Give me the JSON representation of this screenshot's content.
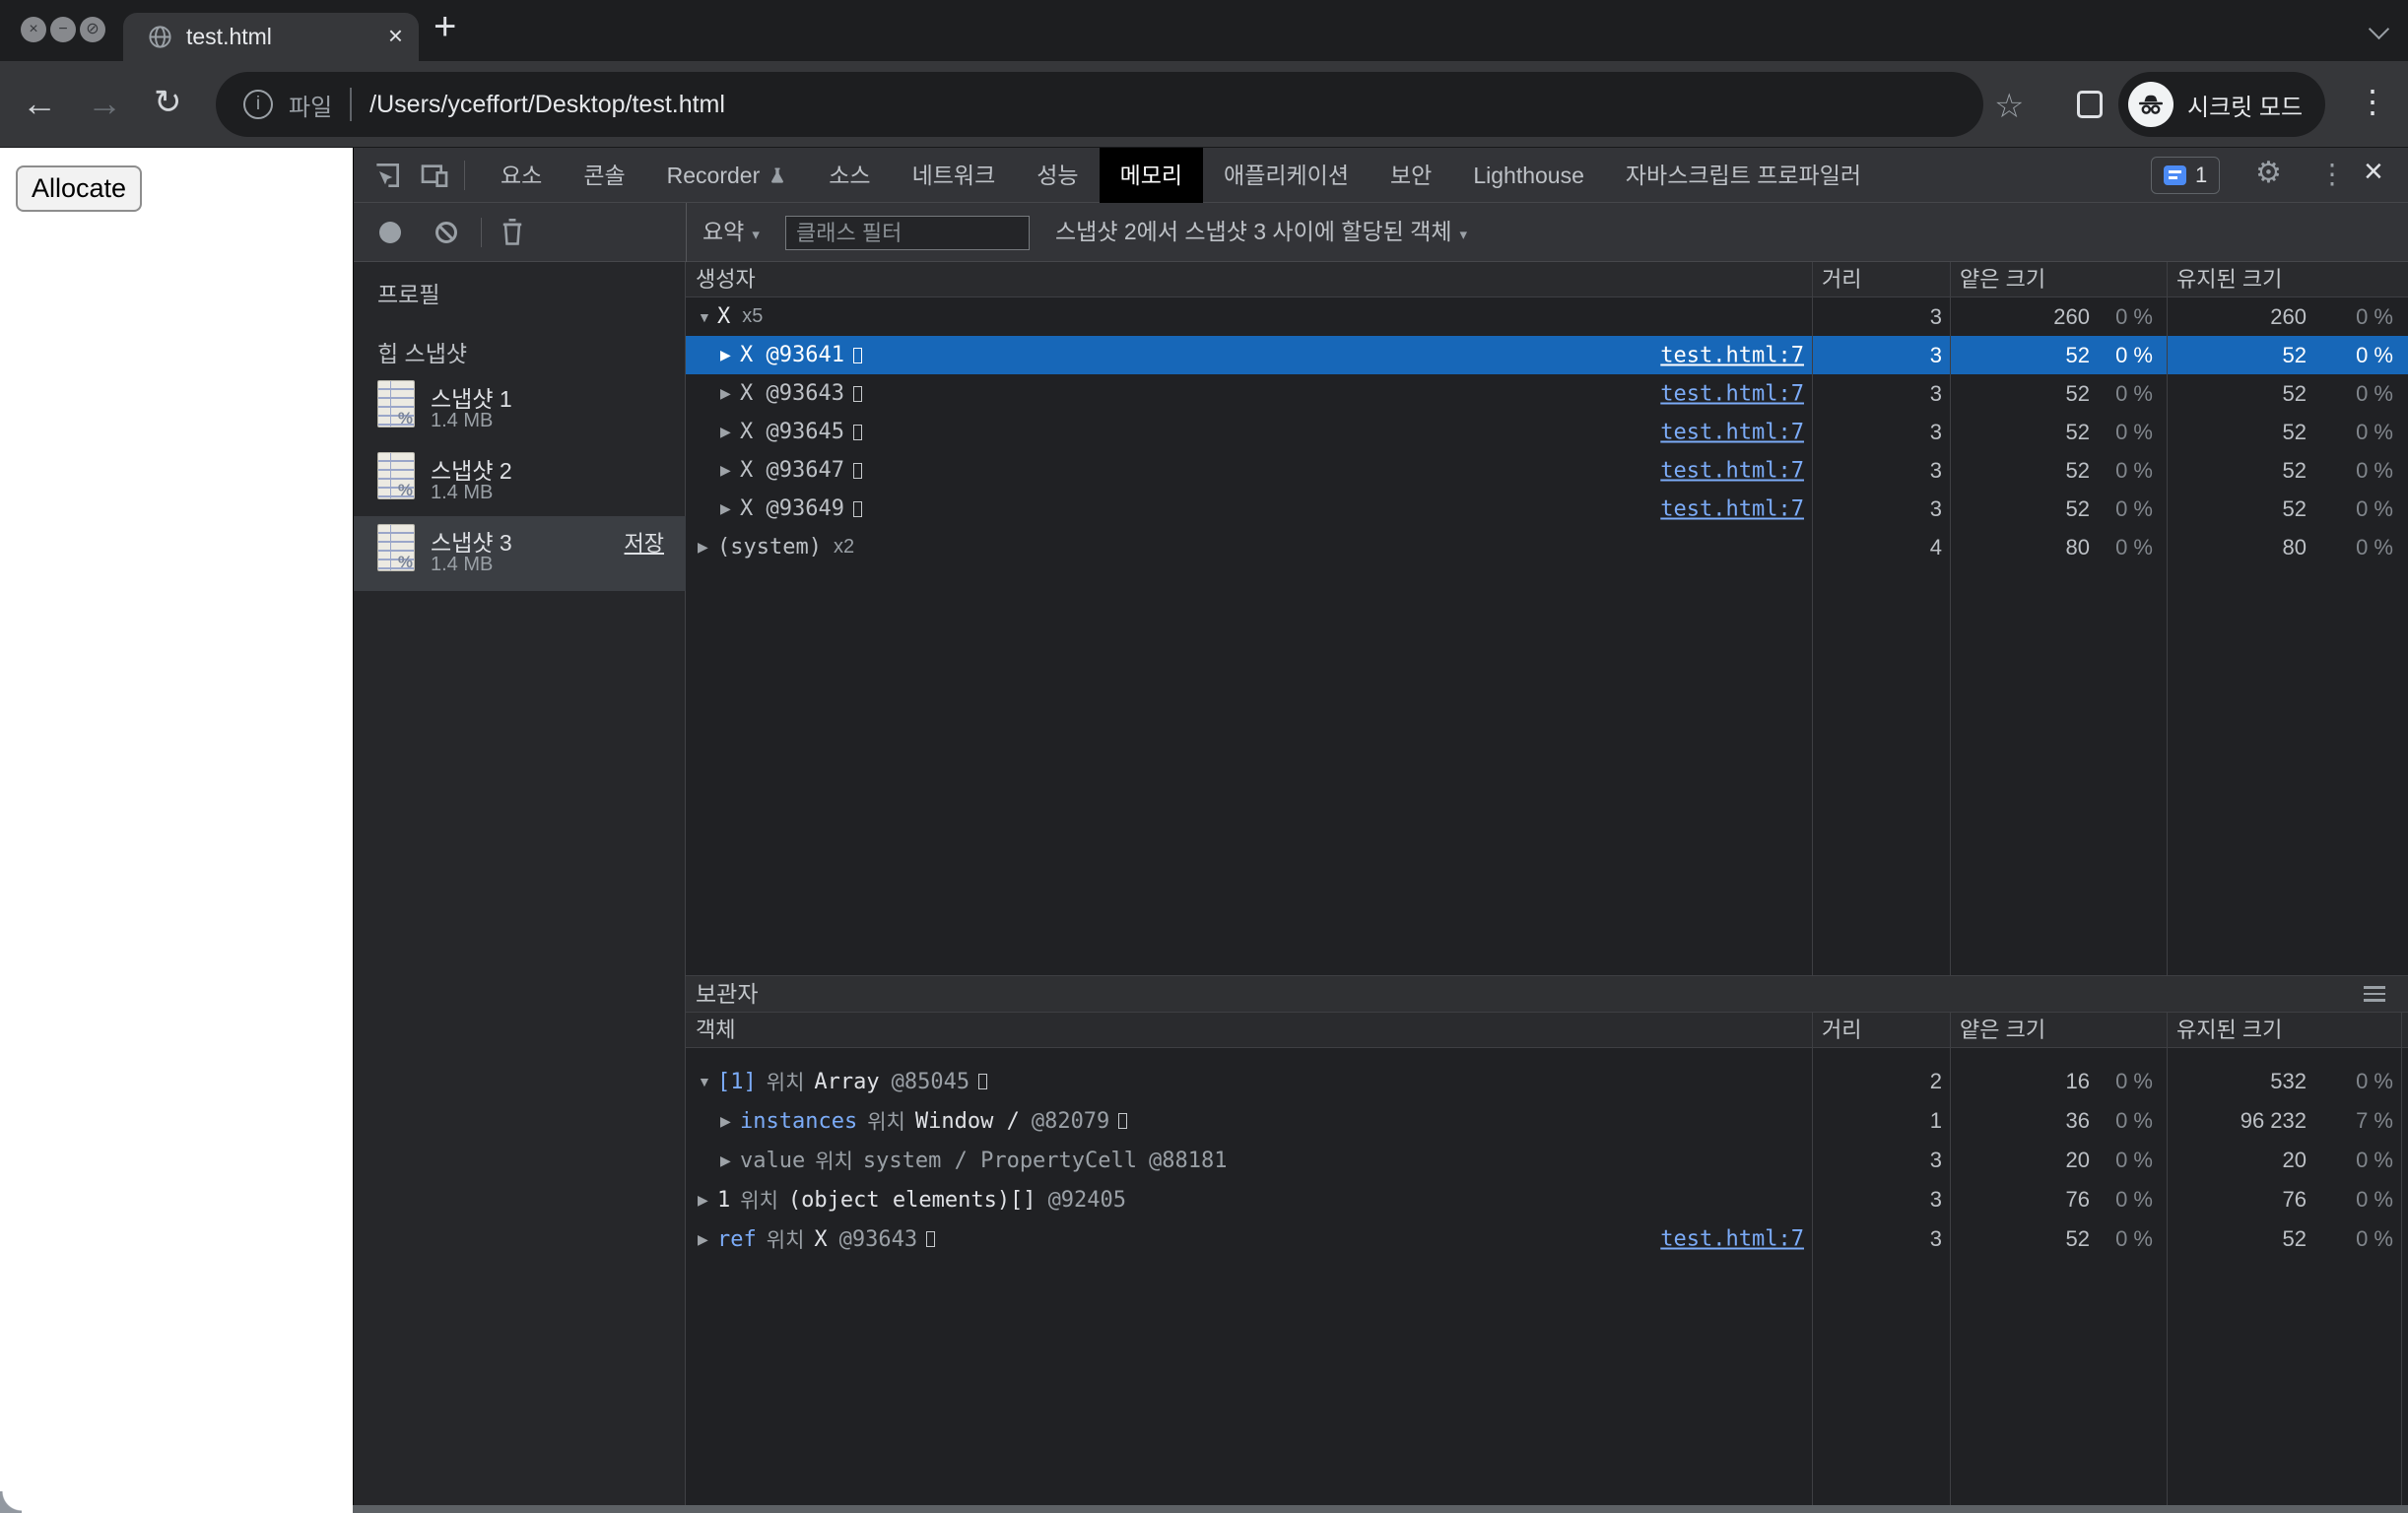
{
  "colors": {
    "selection_blue": "#1767b8",
    "link_blue": "#7cacf8",
    "devtools_bg": "#202124",
    "toolbar_bg": "#333438"
  },
  "browser": {
    "window_controls": {
      "close": "×",
      "minimize": "−",
      "block": "⊘"
    },
    "tab": {
      "title": "test.html",
      "close_glyph": "×"
    },
    "new_tab_glyph": "+",
    "nav": {
      "back": "←",
      "forward": "→",
      "reload": "↻"
    },
    "url": {
      "info_glyph": "i",
      "site_button": "파일",
      "address": "/Users/yceffort/Desktop/test.html"
    },
    "actions": {
      "bookmark_glyph": "☆",
      "incognito_label": "시크릿 모드",
      "menu_glyph": "⋮"
    }
  },
  "page": {
    "allocate_button": "Allocate"
  },
  "devtools": {
    "tabs": [
      "요소",
      "콘솔",
      "Recorder",
      "소스",
      "네트워크",
      "성능",
      "메모리",
      "애플리케이션",
      "보안",
      "Lighthouse",
      "자바스크립트 프로파일러"
    ],
    "active_tab": "메모리",
    "issues_count": "1",
    "controls": {
      "settings_glyph": "⚙",
      "menu_glyph": "⋮",
      "close_glyph": "×"
    },
    "toolbar": {
      "summary_label": "요약",
      "caret": "▾",
      "filter_placeholder": "클래스 필터",
      "allocation_scope": "스냅샷 2에서 스냅샷 3 사이에 할당된 객체"
    },
    "sidebar": {
      "profiles_label": "프로필",
      "heap_section_label": "힙 스냅샷",
      "save_label": "저장",
      "snapshots": [
        {
          "name": "스냅샷 1",
          "size": "1.4 MB"
        },
        {
          "name": "스냅샷 2",
          "size": "1.4 MB"
        },
        {
          "name": "스냅샷 3",
          "size": "1.4 MB"
        }
      ]
    },
    "grid": {
      "columns": {
        "constructor": "생성자",
        "distance": "거리",
        "shallow": "얕은 크기",
        "retained": "유지된 크기"
      },
      "rows": [
        {
          "tri": "▼",
          "name": "X",
          "count": "x5",
          "distance": "3",
          "shallow": "260",
          "shallow_pct": "0 %",
          "retained": "260",
          "retained_pct": "0 %"
        },
        {
          "tri": "▶",
          "name": "X @93641",
          "link": "test.html:7",
          "distance": "3",
          "shallow": "52",
          "shallow_pct": "0 %",
          "retained": "52",
          "retained_pct": "0 %"
        },
        {
          "tri": "▶",
          "name": "X @93643",
          "link": "test.html:7",
          "distance": "3",
          "shallow": "52",
          "shallow_pct": "0 %",
          "retained": "52",
          "retained_pct": "0 %"
        },
        {
          "tri": "▶",
          "name": "X @93645",
          "link": "test.html:7",
          "distance": "3",
          "shallow": "52",
          "shallow_pct": "0 %",
          "retained": "52",
          "retained_pct": "0 %"
        },
        {
          "tri": "▶",
          "name": "X @93647",
          "link": "test.html:7",
          "distance": "3",
          "shallow": "52",
          "shallow_pct": "0 %",
          "retained": "52",
          "retained_pct": "0 %"
        },
        {
          "tri": "▶",
          "name": "X @93649",
          "link": "test.html:7",
          "distance": "3",
          "shallow": "52",
          "shallow_pct": "0 %",
          "retained": "52",
          "retained_pct": "0 %"
        },
        {
          "tri": "▶",
          "name": "(system)",
          "count": "x2",
          "distance": "4",
          "shallow": "80",
          "shallow_pct": "0 %",
          "retained": "80",
          "retained_pct": "0 %"
        }
      ]
    },
    "retainers": {
      "title": "보관자",
      "columns": {
        "object": "객체",
        "distance": "거리",
        "shallow": "얕은 크기",
        "retained": "유지된 크기"
      },
      "rows": [
        {
          "tri": "▼",
          "prop": "[1]",
          "loc": "위치",
          "obj": "Array",
          "id": "@85045",
          "distance": "2",
          "shallow": "16",
          "shallow_pct": "0 %",
          "retained": "532",
          "retained_pct": "0 %"
        },
        {
          "tri": "▶",
          "prop": "instances",
          "loc": "위치",
          "obj": "Window /",
          "id": "@82079",
          "distance": "1",
          "shallow": "36",
          "shallow_pct": "0 %",
          "retained": "96 232",
          "retained_pct": "7 %"
        },
        {
          "tri": "▶",
          "prop": "value",
          "loc": "위치",
          "obj": "system / PropertyCell",
          "id": "@88181",
          "distance": "3",
          "shallow": "20",
          "shallow_pct": "0 %",
          "retained": "20",
          "retained_pct": "0 %"
        },
        {
          "tri": "▶",
          "prop": "1",
          "loc": "위치",
          "obj": "(object elements)[]",
          "id": "@92405",
          "distance": "3",
          "shallow": "76",
          "shallow_pct": "0 %",
          "retained": "76",
          "retained_pct": "0 %"
        },
        {
          "tri": "▶",
          "prop": "ref",
          "loc": "위치",
          "obj": "X",
          "id": "@93643",
          "link": "test.html:7",
          "distance": "3",
          "shallow": "52",
          "shallow_pct": "0 %",
          "retained": "52",
          "retained_pct": "0 %"
        }
      ]
    }
  }
}
